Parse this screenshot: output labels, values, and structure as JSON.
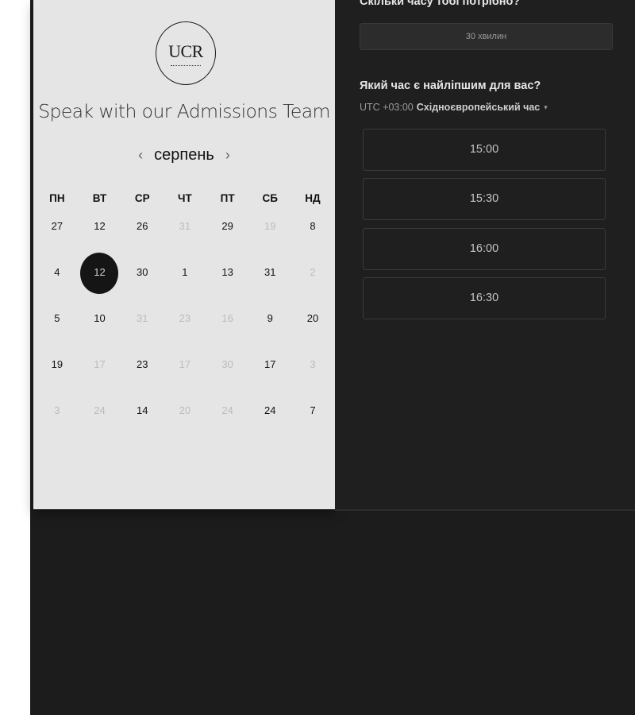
{
  "branding": {
    "logo_text": "UCR",
    "title": "Speak with our Admissions Team"
  },
  "calendar": {
    "month": "серпень",
    "prev_icon": "‹",
    "next_icon": "›",
    "weekdays": [
      "ПН",
      "ВТ",
      "СР",
      "ЧТ",
      "ПТ",
      "СБ",
      "НД"
    ],
    "weeks": [
      [
        "27",
        "12",
        "26",
        "31",
        "29",
        "19",
        "8"
      ],
      [
        "4",
        "12",
        "30",
        "1",
        "13",
        "31",
        "2"
      ],
      [
        "5",
        "10",
        "31",
        "23",
        "16",
        "9",
        "20"
      ],
      [
        "19",
        "17",
        "23",
        "17",
        "30",
        "17",
        "3"
      ],
      [
        "3",
        "24",
        "14",
        "20",
        "24",
        "24",
        "7"
      ]
    ],
    "selected_day": "12"
  },
  "scheduling": {
    "duration_question": "Скільки часу тобі потрібно?",
    "duration_value": "30 хвилин",
    "time_question": "Який час є найліпшим для вас?",
    "timezone_offset": "UTC +03:00",
    "timezone_name": "Східноєвропейський час",
    "timezone_caret": "▾",
    "slots": [
      "15:00",
      "15:30",
      "16:00",
      "16:30"
    ]
  }
}
